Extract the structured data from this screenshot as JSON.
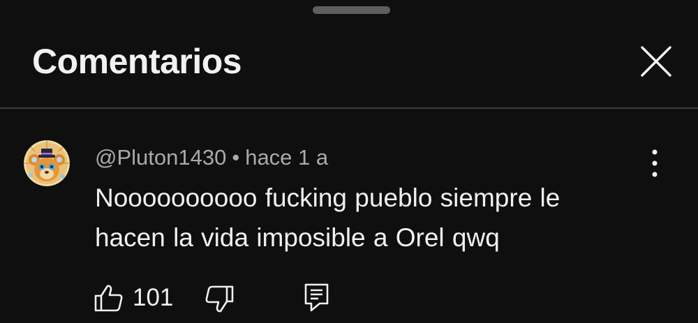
{
  "panel": {
    "title": "Comentarios",
    "close_icon": "close-icon"
  },
  "comment": {
    "author": "@Pluton1430",
    "separator": "•",
    "time": "hace 1 a",
    "text": "Noooooooooo fucking pueblo siempre le hacen la vida imposible a Orel qwq",
    "likes": "101",
    "avatar_icon": "cartoon-bear-avatar",
    "more_icon": "more-vertical-icon",
    "like_icon": "thumbs-up-icon",
    "dislike_icon": "thumbs-down-icon",
    "reply_icon": "reply-comment-icon"
  },
  "colors": {
    "background": "#0f0f0f",
    "text_primary": "#f1f1f1",
    "text_secondary": "#aaaaaa",
    "divider": "#3d3d3d",
    "handle": "#5f5f5f"
  }
}
